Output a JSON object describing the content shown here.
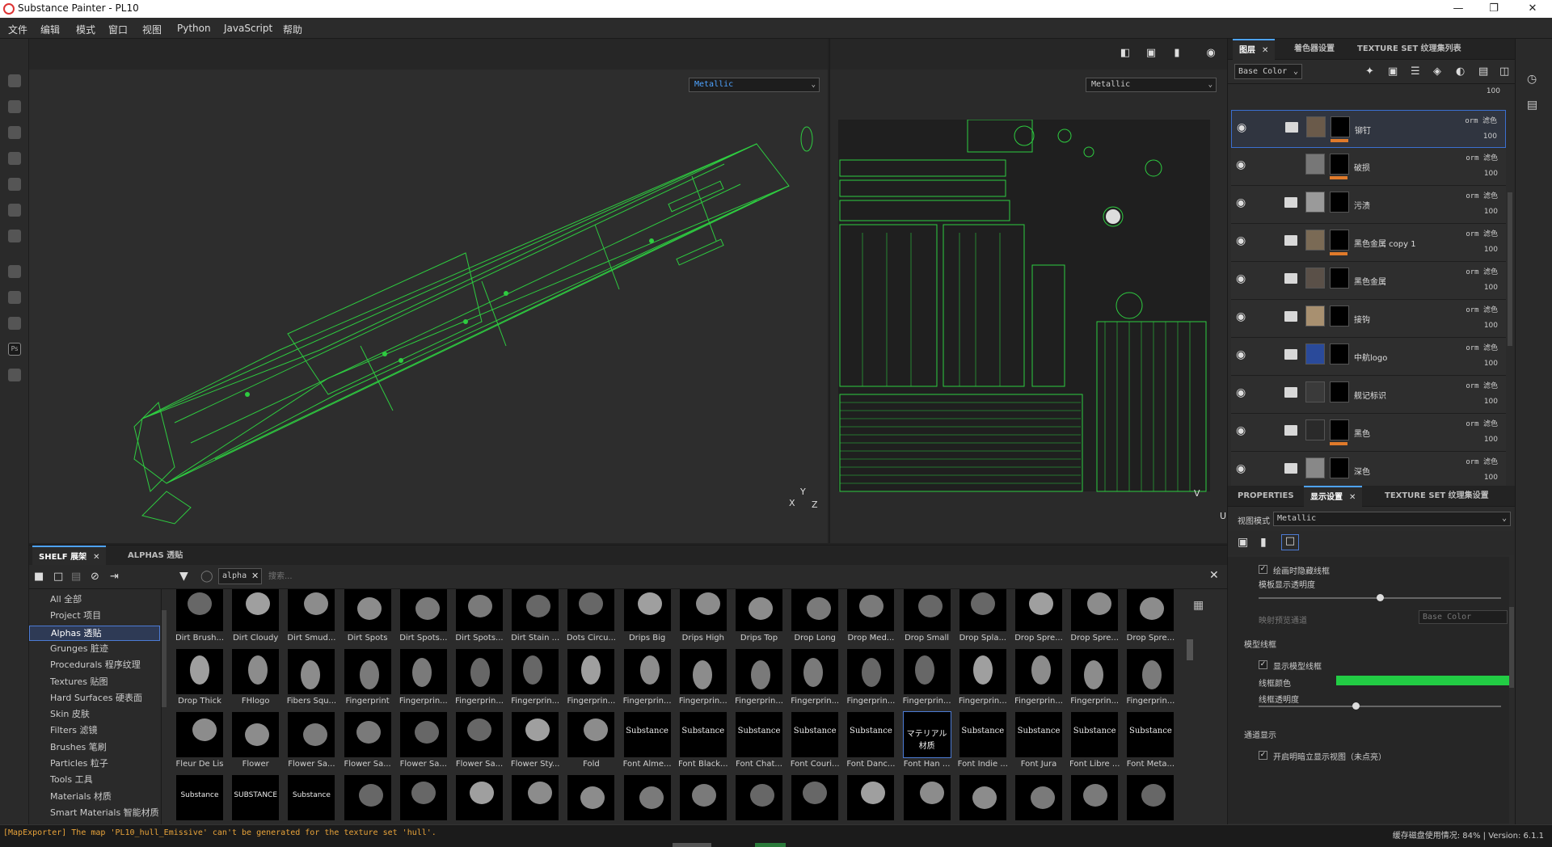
{
  "app": {
    "title": "Substance Painter - PL10"
  },
  "menu": [
    "文件",
    "编辑",
    "模式",
    "窗口",
    "视图",
    "Python",
    "JavaScript",
    "帮助"
  ],
  "viewport": {
    "left_channel": "Metallic",
    "right_channel": "Metallic",
    "axis_y": "Y",
    "axis_x": "X",
    "axis_z": "Z",
    "uv_v": "V",
    "uv_u": "U"
  },
  "right_panel": {
    "tabs": [
      {
        "label": "图层",
        "active": true,
        "closable": true
      },
      {
        "label": "着色器设置",
        "active": false
      },
      {
        "label": "TEXTURE SET 纹理集列表",
        "active": false
      }
    ],
    "channel": "Base Color",
    "top_opacity": "100",
    "layers": [
      {
        "name": "铆钉",
        "blend": "orm 滤色",
        "opacity": "100",
        "selected": true,
        "folder": true,
        "thumb": "#6a5a4a",
        "orange": true
      },
      {
        "name": "破损",
        "blend": "orm 滤色",
        "opacity": "100",
        "selected": false,
        "folder": false,
        "thumb": "#777777",
        "orange": true
      },
      {
        "name": "污渍",
        "blend": "orm 滤色",
        "opacity": "100",
        "selected": false,
        "folder": true,
        "thumb": "#9a9a9a",
        "orange": false
      },
      {
        "name": "黑色金属 copy 1",
        "blend": "orm 滤色",
        "opacity": "100",
        "selected": false,
        "folder": true,
        "thumb": "#7a6a55",
        "orange": true
      },
      {
        "name": "黑色金属",
        "blend": "orm 滤色",
        "opacity": "100",
        "selected": false,
        "folder": true,
        "thumb": "#5a5048",
        "orange": false
      },
      {
        "name": "接钩",
        "blend": "orm 滤色",
        "opacity": "100",
        "selected": false,
        "folder": true,
        "thumb": "#a89070",
        "orange": false
      },
      {
        "name": "中航logo",
        "blend": "orm 滤色",
        "opacity": "100",
        "selected": false,
        "folder": true,
        "thumb": "#2a4a9a",
        "orange": false
      },
      {
        "name": "舰记标识",
        "blend": "orm 滤色",
        "opacity": "100",
        "selected": false,
        "folder": true,
        "thumb": "#3a3a3a",
        "orange": false
      },
      {
        "name": "黑色",
        "blend": "orm 滤色",
        "opacity": "100",
        "selected": false,
        "folder": true,
        "thumb": "#2a2a2a",
        "orange": true
      },
      {
        "name": "深色",
        "blend": "orm 滤色",
        "opacity": "100",
        "selected": false,
        "folder": true,
        "thumb": "#888888",
        "orange": false
      }
    ],
    "props_tabs": [
      {
        "label": "PROPERTIES",
        "active": false
      },
      {
        "label": "显示设置",
        "active": true,
        "closable": true
      },
      {
        "label": "TEXTURE SET 纹理集设置",
        "active": false
      }
    ],
    "view_mode_label": "视图模式",
    "view_mode_value": "Metallic",
    "hide_when_painting": "绘画时隐藏线框",
    "model_opacity_label": "模板显示透明度",
    "model_opacity": 0.5,
    "map_channel_label": "映射预览通道",
    "map_channel_value": "Base Color",
    "wireframe_section": "模型线框",
    "show_wireframe": "显示模型线框",
    "wire_color_label": "线框颜色",
    "wire_color": "#22cc44",
    "wire_opacity_label": "线框透明度",
    "wire_opacity": 0.4,
    "channel_section": "通道显示",
    "channel_option": "开启明暗立显示视图（未点亮）"
  },
  "shelf": {
    "tabs": [
      {
        "label": "SHELF 展架",
        "active": true,
        "closable": true
      },
      {
        "label": "ALPHAS 透贴",
        "active": false
      }
    ],
    "filter_tag": "alpha",
    "search_placeholder": "搜索...",
    "categories": [
      "All 全部",
      "Project 项目",
      "Alphas 透贴",
      "Grunges 脏迹",
      "Procedurals 程序纹理",
      "Textures 贴图",
      "Hard Surfaces 硬表面",
      "Skin 皮肤",
      "Filters 滤镜",
      "Brushes 笔刷",
      "Particles 粒子",
      "Tools 工具",
      "Materials 材质",
      "Smart Materials 智能材质"
    ],
    "selected_category": "Alphas 透贴",
    "rows": [
      [
        "Dirt Brush...",
        "Dirt Cloudy",
        "Dirt Smud...",
        "Dirt Spots",
        "Dirt Spots...",
        "Dirt Spots...",
        "Dirt Stain ...",
        "Dots Circu...",
        "Drips Big",
        "Drips High",
        "Drips Top",
        "Drop Long",
        "Drop Med...",
        "Drop Small",
        "Drop Spla...",
        "Drop Spre...",
        "Drop Spre...",
        "Drop Spre..."
      ],
      [
        "Drop Thick",
        "FHlogo",
        "Fibers Squ...",
        "Fingerprint",
        "Fingerprin...",
        "Fingerprin...",
        "Fingerprin...",
        "Fingerprin...",
        "Fingerprin...",
        "Fingerprin...",
        "Fingerprin...",
        "Fingerprin...",
        "Fingerprin...",
        "Fingerprin...",
        "Fingerprin...",
        "Fingerprin...",
        "Fingerprin...",
        "Fingerprin..."
      ],
      [
        "Fleur De Lis",
        "Flower",
        "Flower Sa...",
        "Flower Sa...",
        "Flower Sa...",
        "Flower Sa...",
        "Flower Sty...",
        "Fold",
        "Font Alme...",
        "Font Black...",
        "Font Chat...",
        "Font Couri...",
        "Font Danc...",
        "Font Han ...",
        "Font Indie ...",
        "Font Jura",
        "Font Libre ...",
        "Font Meta..."
      ],
      [
        "",
        "",
        "",
        "",
        "",
        "",
        "",
        "",
        "",
        "",
        "",
        "",
        "",
        "",
        "",
        "",
        "",
        ""
      ]
    ],
    "font_previews": [
      "Substance",
      "Substance",
      "Substance",
      "Substance",
      "Substance",
      "マテリアル材质",
      "Substance",
      "Substance",
      "Substance",
      "Substance"
    ],
    "row4_previews": [
      "Substance",
      "SUBSTANCE",
      "Substance"
    ]
  },
  "status": {
    "error": "[MapExporter] The map 'PL10_hull_Emissive' can't be generated for the texture set 'hull'.",
    "disk": "缓存磁盘使用情况:  84%  |  Version: 6.1.1"
  }
}
